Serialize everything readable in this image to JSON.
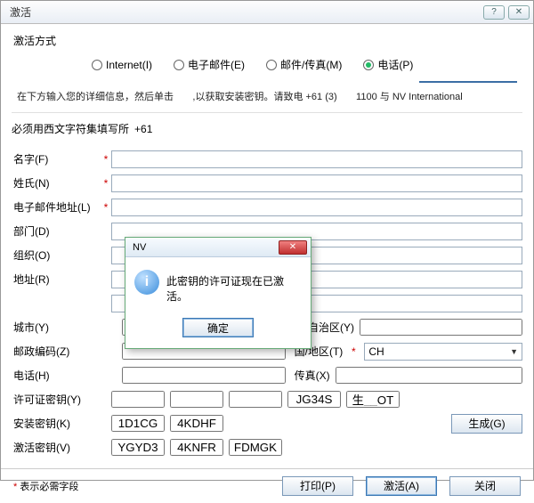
{
  "window": {
    "title": "激活"
  },
  "activation_method": {
    "label": "激活方式",
    "options": {
      "internet": "Internet(I)",
      "email": "电子邮件(E)",
      "fax": "邮件/传真(M)",
      "phone": "电话(P)"
    },
    "selected": "phone"
  },
  "instructions": "在下方输入您的详细信息，然后单击       ,以获取安装密钥。请致电 +61 (3)       1100 与 NV International",
  "required_note": "必须用西文字符集填写所",
  "required_value": "+61",
  "fields": {
    "first_name": "名字(F)",
    "last_name": "姓氏(N)",
    "email": "电子邮件地址(L)",
    "department": "部门(D)",
    "organization": "组织(O)",
    "address": "地址(R)",
    "city": "城市(Y)",
    "postal": "邮政编码(Z)",
    "phone": "电话(H)",
    "license": "许可证密钥(Y)",
    "install": "安装密钥(K)",
    "activation": "激活密钥(V)",
    "state": "州/自治区(Y)",
    "country": "国/地区(T)",
    "fax": "传真(X)"
  },
  "country_value": "CH",
  "license_values": [
    "",
    "",
    "",
    "JG34S",
    "生__OT"
  ],
  "install_values": [
    "1D1CG",
    "4KDHF"
  ],
  "activation_values": [
    "YGYD3",
    "4KNFR",
    "FDMGK"
  ],
  "buttons": {
    "generate": "生成(G)",
    "print": "打印(P)",
    "activate": "激活(A)",
    "close": "关闭"
  },
  "footer_note": "表示必需字段",
  "modal": {
    "title": "NV",
    "message": "此密钥的许可证现在已激活。",
    "ok": "确定"
  }
}
